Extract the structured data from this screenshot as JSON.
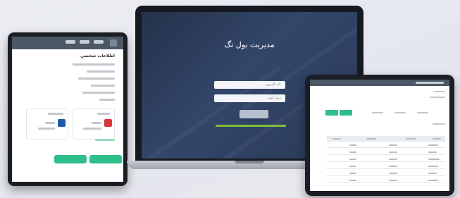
{
  "laptop": {
    "login_title": "مديريت بول تگ",
    "login_subtitle": "",
    "username_placeholder": "نام کاربری",
    "password_placeholder": "رمز عبور",
    "submit_label": ""
  },
  "tablet_left": {
    "heading": "اطلاعات شخصي"
  },
  "tablet_right": {},
  "colors": {
    "accent_green": "#2fbf8a",
    "header_gray": "#4d5866",
    "login_bg": "#2a3956"
  }
}
